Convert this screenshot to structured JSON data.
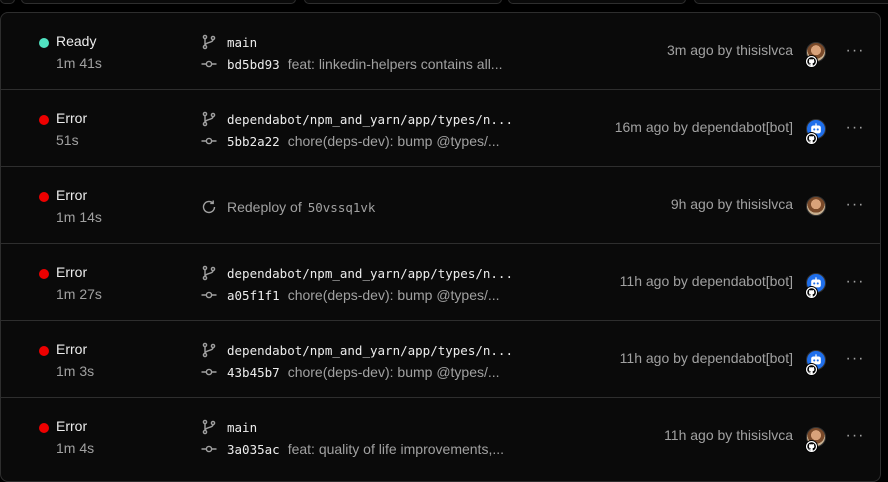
{
  "colors": {
    "ready": "#50e3c2",
    "error": "#ee0000",
    "bot_avatar": "#1f6feb",
    "border": "#2e2e2e"
  },
  "icons": {
    "branch": "git-branch-icon",
    "commit": "git-commit-icon",
    "redeploy": "redeploy-icon",
    "more": "more-horizontal-icon",
    "github_badge": "github-icon"
  },
  "deployments": [
    {
      "status": "Ready",
      "status_kind": "ready",
      "duration": "1m 41s",
      "branch": "main",
      "sha": "bd5bd93",
      "message": "feat: linkedin-helpers contains all...",
      "when": "3m ago by thisislvca",
      "avatar": "person",
      "more": "···"
    },
    {
      "status": "Error",
      "status_kind": "error",
      "duration": "51s",
      "branch": "dependabot/npm_and_yarn/app/types/n...",
      "sha": "5bb2a22",
      "message": "chore(deps-dev): bump @types/...",
      "when": "16m ago by dependabot[bot]",
      "avatar": "bot",
      "more": "···"
    },
    {
      "status": "Error",
      "status_kind": "error",
      "duration": "1m 14s",
      "redeploy_label": "Redeploy of",
      "redeploy_id": "50vssq1vk",
      "when": "9h ago by thisislvca",
      "avatar": "person",
      "more": "···"
    },
    {
      "status": "Error",
      "status_kind": "error",
      "duration": "1m 27s",
      "branch": "dependabot/npm_and_yarn/app/types/n...",
      "sha": "a05f1f1",
      "message": "chore(deps-dev): bump @types/...",
      "when": "11h ago by dependabot[bot]",
      "avatar": "bot",
      "more": "···"
    },
    {
      "status": "Error",
      "status_kind": "error",
      "duration": "1m 3s",
      "branch": "dependabot/npm_and_yarn/app/types/n...",
      "sha": "43b45b7",
      "message": "chore(deps-dev): bump @types/...",
      "when": "11h ago by dependabot[bot]",
      "avatar": "bot",
      "more": "···"
    },
    {
      "status": "Error",
      "status_kind": "error",
      "duration": "1m 4s",
      "branch": "main",
      "sha": "3a035ac",
      "message": "feat: quality of life improvements,...",
      "when": "11h ago by thisislvca",
      "avatar": "person",
      "more": "···"
    }
  ]
}
